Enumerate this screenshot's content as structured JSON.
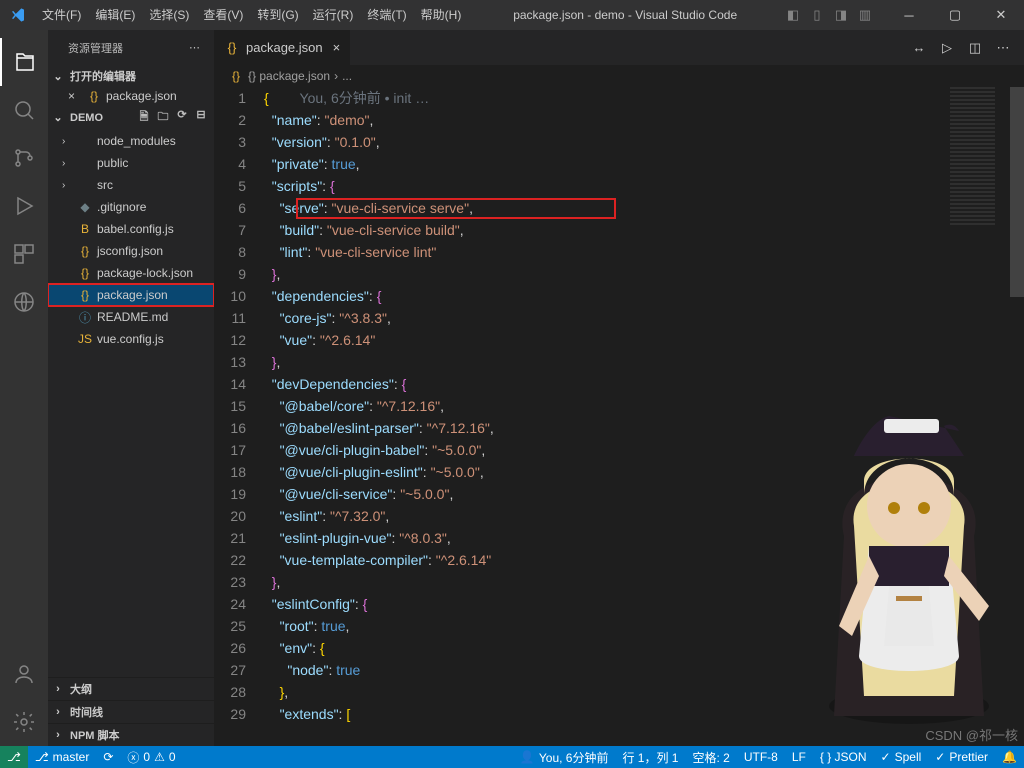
{
  "titlebar": {
    "menu": [
      "文件(F)",
      "编辑(E)",
      "选择(S)",
      "查看(V)",
      "转到(G)",
      "运行(R)",
      "终端(T)",
      "帮助(H)"
    ],
    "title": "package.json - demo - Visual Studio Code"
  },
  "sidebar": {
    "header": "资源管理器",
    "open_editors": "打开的编辑器",
    "open_tab": "package.json",
    "demo_label": "DEMO",
    "tree": [
      {
        "kind": "folder",
        "label": "node_modules",
        "color": "folder-ico"
      },
      {
        "kind": "folder",
        "label": "public",
        "color": "folder-ico"
      },
      {
        "kind": "folder",
        "label": "src",
        "color": "folder-ico"
      },
      {
        "kind": "file",
        "label": ".gitignore",
        "icon": "◆",
        "color": "f-gray"
      },
      {
        "kind": "file",
        "label": "babel.config.js",
        "icon": "B",
        "color": "f-yellow"
      },
      {
        "kind": "file",
        "label": "jsconfig.json",
        "icon": "{}",
        "color": "f-yellow"
      },
      {
        "kind": "file",
        "label": "package-lock.json",
        "icon": "{}",
        "color": "f-yellow"
      },
      {
        "kind": "file",
        "label": "package.json",
        "icon": "{}",
        "color": "f-yellow",
        "selected": true,
        "boxed": true
      },
      {
        "kind": "file",
        "label": "README.md",
        "icon": "ⓘ",
        "color": "f-blue"
      },
      {
        "kind": "file",
        "label": "vue.config.js",
        "icon": "JS",
        "color": "f-yellow"
      }
    ],
    "bottom_sections": [
      "大纲",
      "时间线",
      "NPM 脚本"
    ]
  },
  "editor": {
    "tab": "package.json",
    "breadcrumb": [
      "{} package.json",
      "..."
    ],
    "lens": "You, 6分钟前 • init …",
    "lines": [
      {
        "n": 1,
        "seg": [
          {
            "t": "{",
            "c": "tok-b"
          }
        ]
      },
      {
        "n": 2,
        "seg": [
          {
            "t": "  ",
            "c": "tok-d"
          },
          {
            "t": "\"name\"",
            "c": "tok-k"
          },
          {
            "t": ": ",
            "c": "tok-d"
          },
          {
            "t": "\"demo\"",
            "c": "tok-s"
          },
          {
            "t": ",",
            "c": "tok-d"
          }
        ]
      },
      {
        "n": 3,
        "seg": [
          {
            "t": "  ",
            "c": "tok-d"
          },
          {
            "t": "\"version\"",
            "c": "tok-k"
          },
          {
            "t": ": ",
            "c": "tok-d"
          },
          {
            "t": "\"0.1.0\"",
            "c": "tok-s"
          },
          {
            "t": ",",
            "c": "tok-d"
          }
        ]
      },
      {
        "n": 4,
        "seg": [
          {
            "t": "  ",
            "c": "tok-d"
          },
          {
            "t": "\"private\"",
            "c": "tok-k"
          },
          {
            "t": ": ",
            "c": "tok-d"
          },
          {
            "t": "true",
            "c": "tok-c"
          },
          {
            "t": ",",
            "c": "tok-d"
          }
        ]
      },
      {
        "n": 5,
        "seg": [
          {
            "t": "  ",
            "c": "tok-d"
          },
          {
            "t": "\"scripts\"",
            "c": "tok-k"
          },
          {
            "t": ": ",
            "c": "tok-d"
          },
          {
            "t": "{",
            "c": "tok-p"
          }
        ]
      },
      {
        "n": 6,
        "seg": [
          {
            "t": "    ",
            "c": "tok-d"
          },
          {
            "t": "\"serve\"",
            "c": "tok-k"
          },
          {
            "t": ": ",
            "c": "tok-d"
          },
          {
            "t": "\"vue-cli-service serve\"",
            "c": "tok-s"
          },
          {
            "t": ",",
            "c": "tok-d"
          }
        ],
        "boxed": true
      },
      {
        "n": 7,
        "seg": [
          {
            "t": "    ",
            "c": "tok-d"
          },
          {
            "t": "\"build\"",
            "c": "tok-k"
          },
          {
            "t": ": ",
            "c": "tok-d"
          },
          {
            "t": "\"vue-cli-service build\"",
            "c": "tok-s"
          },
          {
            "t": ",",
            "c": "tok-d"
          }
        ]
      },
      {
        "n": 8,
        "seg": [
          {
            "t": "    ",
            "c": "tok-d"
          },
          {
            "t": "\"lint\"",
            "c": "tok-k"
          },
          {
            "t": ": ",
            "c": "tok-d"
          },
          {
            "t": "\"vue-cli-service lint\"",
            "c": "tok-s"
          }
        ]
      },
      {
        "n": 9,
        "seg": [
          {
            "t": "  ",
            "c": "tok-d"
          },
          {
            "t": "}",
            "c": "tok-p"
          },
          {
            "t": ",",
            "c": "tok-d"
          }
        ]
      },
      {
        "n": 10,
        "seg": [
          {
            "t": "  ",
            "c": "tok-d"
          },
          {
            "t": "\"dependencies\"",
            "c": "tok-k"
          },
          {
            "t": ": ",
            "c": "tok-d"
          },
          {
            "t": "{",
            "c": "tok-p"
          }
        ]
      },
      {
        "n": 11,
        "seg": [
          {
            "t": "    ",
            "c": "tok-d"
          },
          {
            "t": "\"core-js\"",
            "c": "tok-k"
          },
          {
            "t": ": ",
            "c": "tok-d"
          },
          {
            "t": "\"^3.8.3\"",
            "c": "tok-s"
          },
          {
            "t": ",",
            "c": "tok-d"
          }
        ]
      },
      {
        "n": 12,
        "seg": [
          {
            "t": "    ",
            "c": "tok-d"
          },
          {
            "t": "\"vue\"",
            "c": "tok-k"
          },
          {
            "t": ": ",
            "c": "tok-d"
          },
          {
            "t": "\"^2.6.14\"",
            "c": "tok-s"
          }
        ]
      },
      {
        "n": 13,
        "seg": [
          {
            "t": "  ",
            "c": "tok-d"
          },
          {
            "t": "}",
            "c": "tok-p"
          },
          {
            "t": ",",
            "c": "tok-d"
          }
        ]
      },
      {
        "n": 14,
        "seg": [
          {
            "t": "  ",
            "c": "tok-d"
          },
          {
            "t": "\"devDependencies\"",
            "c": "tok-k"
          },
          {
            "t": ": ",
            "c": "tok-d"
          },
          {
            "t": "{",
            "c": "tok-p"
          }
        ]
      },
      {
        "n": 15,
        "seg": [
          {
            "t": "    ",
            "c": "tok-d"
          },
          {
            "t": "\"@babel/core\"",
            "c": "tok-k"
          },
          {
            "t": ": ",
            "c": "tok-d"
          },
          {
            "t": "\"^7.12.16\"",
            "c": "tok-s"
          },
          {
            "t": ",",
            "c": "tok-d"
          }
        ]
      },
      {
        "n": 16,
        "seg": [
          {
            "t": "    ",
            "c": "tok-d"
          },
          {
            "t": "\"@babel/eslint-parser\"",
            "c": "tok-k"
          },
          {
            "t": ": ",
            "c": "tok-d"
          },
          {
            "t": "\"^7.12.16\"",
            "c": "tok-s"
          },
          {
            "t": ",",
            "c": "tok-d"
          }
        ]
      },
      {
        "n": 17,
        "seg": [
          {
            "t": "    ",
            "c": "tok-d"
          },
          {
            "t": "\"@vue/cli-plugin-babel\"",
            "c": "tok-k"
          },
          {
            "t": ": ",
            "c": "tok-d"
          },
          {
            "t": "\"~5.0.0\"",
            "c": "tok-s"
          },
          {
            "t": ",",
            "c": "tok-d"
          }
        ]
      },
      {
        "n": 18,
        "seg": [
          {
            "t": "    ",
            "c": "tok-d"
          },
          {
            "t": "\"@vue/cli-plugin-eslint\"",
            "c": "tok-k"
          },
          {
            "t": ": ",
            "c": "tok-d"
          },
          {
            "t": "\"~5.0.0\"",
            "c": "tok-s"
          },
          {
            "t": ",",
            "c": "tok-d"
          }
        ]
      },
      {
        "n": 19,
        "seg": [
          {
            "t": "    ",
            "c": "tok-d"
          },
          {
            "t": "\"@vue/cli-service\"",
            "c": "tok-k"
          },
          {
            "t": ": ",
            "c": "tok-d"
          },
          {
            "t": "\"~5.0.0\"",
            "c": "tok-s"
          },
          {
            "t": ",",
            "c": "tok-d"
          }
        ]
      },
      {
        "n": 20,
        "seg": [
          {
            "t": "    ",
            "c": "tok-d"
          },
          {
            "t": "\"eslint\"",
            "c": "tok-k"
          },
          {
            "t": ": ",
            "c": "tok-d"
          },
          {
            "t": "\"^7.32.0\"",
            "c": "tok-s"
          },
          {
            "t": ",",
            "c": "tok-d"
          }
        ]
      },
      {
        "n": 21,
        "seg": [
          {
            "t": "    ",
            "c": "tok-d"
          },
          {
            "t": "\"eslint-plugin-vue\"",
            "c": "tok-k"
          },
          {
            "t": ": ",
            "c": "tok-d"
          },
          {
            "t": "\"^8.0.3\"",
            "c": "tok-s"
          },
          {
            "t": ",",
            "c": "tok-d"
          }
        ]
      },
      {
        "n": 22,
        "seg": [
          {
            "t": "    ",
            "c": "tok-d"
          },
          {
            "t": "\"vue-template-compiler\"",
            "c": "tok-k"
          },
          {
            "t": ": ",
            "c": "tok-d"
          },
          {
            "t": "\"^2.6.14\"",
            "c": "tok-s"
          }
        ]
      },
      {
        "n": 23,
        "seg": [
          {
            "t": "  ",
            "c": "tok-d"
          },
          {
            "t": "}",
            "c": "tok-p"
          },
          {
            "t": ",",
            "c": "tok-d"
          }
        ]
      },
      {
        "n": 24,
        "seg": [
          {
            "t": "  ",
            "c": "tok-d"
          },
          {
            "t": "\"eslintConfig\"",
            "c": "tok-k"
          },
          {
            "t": ": ",
            "c": "tok-d"
          },
          {
            "t": "{",
            "c": "tok-p"
          }
        ]
      },
      {
        "n": 25,
        "seg": [
          {
            "t": "    ",
            "c": "tok-d"
          },
          {
            "t": "\"root\"",
            "c": "tok-k"
          },
          {
            "t": ": ",
            "c": "tok-d"
          },
          {
            "t": "true",
            "c": "tok-c"
          },
          {
            "t": ",",
            "c": "tok-d"
          }
        ]
      },
      {
        "n": 26,
        "seg": [
          {
            "t": "    ",
            "c": "tok-d"
          },
          {
            "t": "\"env\"",
            "c": "tok-k"
          },
          {
            "t": ": ",
            "c": "tok-d"
          },
          {
            "t": "{",
            "c": "tok-b"
          }
        ]
      },
      {
        "n": 27,
        "seg": [
          {
            "t": "      ",
            "c": "tok-d"
          },
          {
            "t": "\"node\"",
            "c": "tok-k"
          },
          {
            "t": ": ",
            "c": "tok-d"
          },
          {
            "t": "true",
            "c": "tok-c"
          }
        ]
      },
      {
        "n": 28,
        "seg": [
          {
            "t": "    ",
            "c": "tok-d"
          },
          {
            "t": "}",
            "c": "tok-b"
          },
          {
            "t": ",",
            "c": "tok-d"
          }
        ]
      },
      {
        "n": 29,
        "seg": [
          {
            "t": "    ",
            "c": "tok-d"
          },
          {
            "t": "\"extends\"",
            "c": "tok-k"
          },
          {
            "t": ": ",
            "c": "tok-d"
          },
          {
            "t": "[",
            "c": "tok-b"
          }
        ]
      }
    ]
  },
  "status": {
    "branch": "master",
    "sync": "",
    "errors": "0",
    "warnings": "0",
    "blame": "You, 6分钟前",
    "pos": "行 1，列 1",
    "spaces": "空格: 2",
    "enc": "UTF-8",
    "eol": "LF",
    "lang": "{ } JSON",
    "spell": "Spell",
    "prettier": "Prettier"
  },
  "watermark": "CSDN @祁一核"
}
